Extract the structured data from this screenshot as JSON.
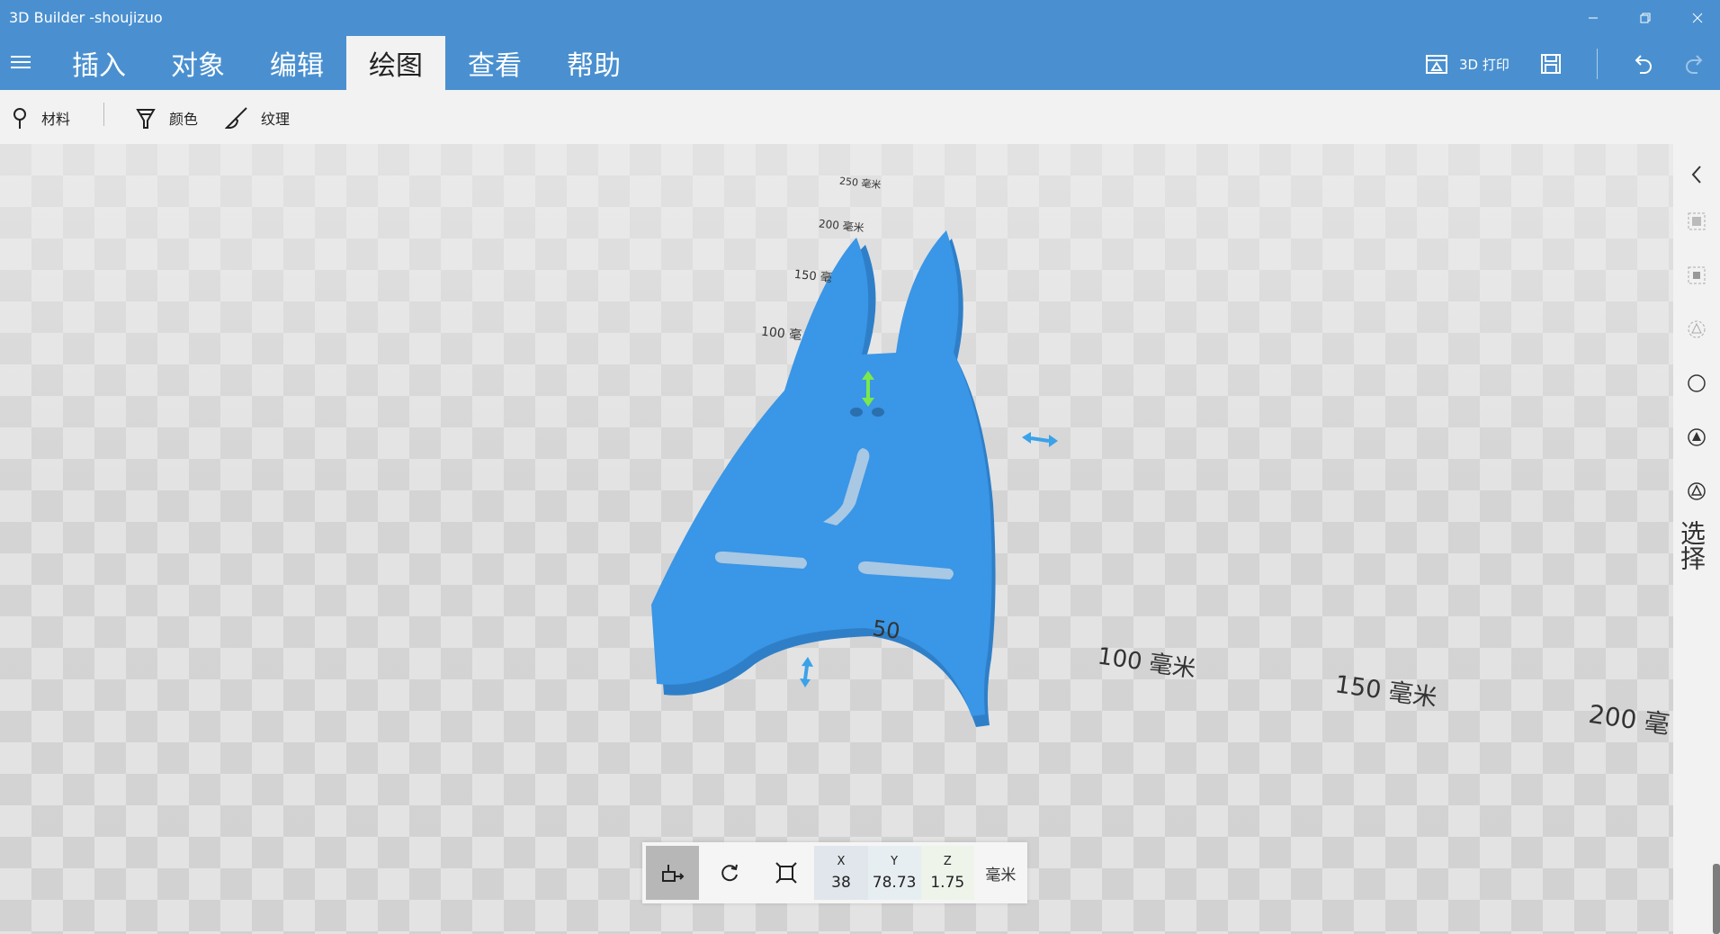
{
  "window": {
    "title": "3D Builder -shoujizuo"
  },
  "ribbon": {
    "tabs": [
      {
        "label": "插入"
      },
      {
        "label": "对象"
      },
      {
        "label": "编辑"
      },
      {
        "label": "绘图",
        "active": true
      },
      {
        "label": "查看"
      },
      {
        "label": "帮助"
      }
    ],
    "print_label": "3D 打印",
    "accent_color": "#4a90d0"
  },
  "toolbar": {
    "material_label": "材料",
    "color_label": "颜色",
    "texture_label": "纹理"
  },
  "viewport": {
    "grid_labels_far": [
      "250 毫米",
      "200 毫米",
      "150 毫",
      "100 毫"
    ],
    "grid_labels_near": [
      "50",
      "100 毫米",
      "150 毫米",
      "200 毫"
    ],
    "object_color": "#3a96e6",
    "gizmo_colors": {
      "vertical": "#7be84c",
      "horizontal": "#3aa2e8"
    }
  },
  "right_panel": {
    "label": "选择"
  },
  "transform": {
    "x_label": "X",
    "x_value": "38",
    "y_label": "Y",
    "y_value": "78.73",
    "z_label": "Z",
    "z_value": "1.75",
    "unit": "毫米"
  }
}
